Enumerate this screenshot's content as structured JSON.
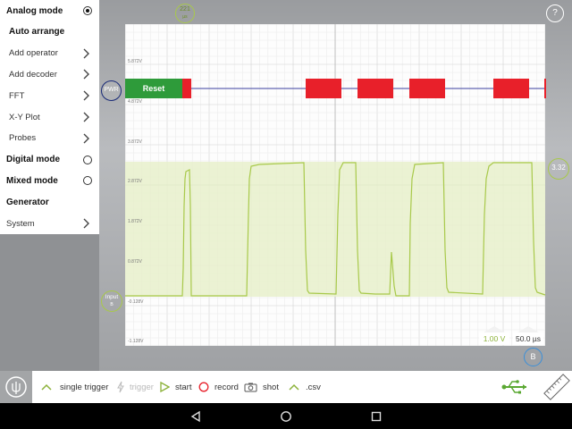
{
  "sidebar": {
    "items": [
      {
        "label": "Analog mode",
        "style": "bold",
        "control": "radio-on"
      },
      {
        "label": "Auto arrange",
        "style": "bold-indent",
        "control": "none"
      },
      {
        "label": "Add operator",
        "style": "indent",
        "control": "chevron"
      },
      {
        "label": "Add decoder",
        "style": "indent",
        "control": "chevron"
      },
      {
        "label": "FFT",
        "style": "indent",
        "control": "chevron"
      },
      {
        "label": "X-Y Plot",
        "style": "indent",
        "control": "chevron"
      },
      {
        "label": "Probes",
        "style": "indent",
        "control": "chevron"
      },
      {
        "label": "Digital mode",
        "style": "bold",
        "control": "radio-off"
      },
      {
        "label": "Mixed mode",
        "style": "bold",
        "control": "radio-off"
      },
      {
        "label": "Generator",
        "style": "bold",
        "control": "none"
      },
      {
        "label": "System",
        "style": "plain",
        "control": "chevron"
      }
    ]
  },
  "scope": {
    "voltage_labels": [
      "5.872V",
      "4.872V",
      "3.872V",
      "2.872V",
      "1.872V",
      "0.872V",
      "-0.128V",
      "-1.128V"
    ],
    "trigger_marker": {
      "value": "221",
      "unit": "µs"
    },
    "pwr_marker": "PWR",
    "input_marker": {
      "line1": "Input",
      "line2": "B"
    },
    "level_marker": "3.32",
    "decoder_label": "Reset",
    "volts_per_div": "1.00 V",
    "time_per_div": "50.0 µs",
    "help": "?",
    "channel_button": "B",
    "colors": {
      "signal": "#a8c94a",
      "reset_block": "#2e9b3a",
      "decoded_block": "#e8202a",
      "highlight_band": "#e9f2cf",
      "pwr_ring": "#1a2b77",
      "channel_ring": "#3a8fd9"
    }
  },
  "toolbar": {
    "single_trigger": "single trigger",
    "trigger": "trigger",
    "start": "start",
    "record": "record",
    "shot": "shot",
    "csv": ".csv"
  },
  "icons": [
    "chevron-right-icon",
    "radio-icon",
    "chevron-up-icon",
    "lightning-icon",
    "play-icon",
    "record-circle-icon",
    "camera-icon",
    "usb-icon",
    "ruler-icon",
    "probe-logo-icon",
    "back-icon",
    "home-icon",
    "recents-icon"
  ]
}
